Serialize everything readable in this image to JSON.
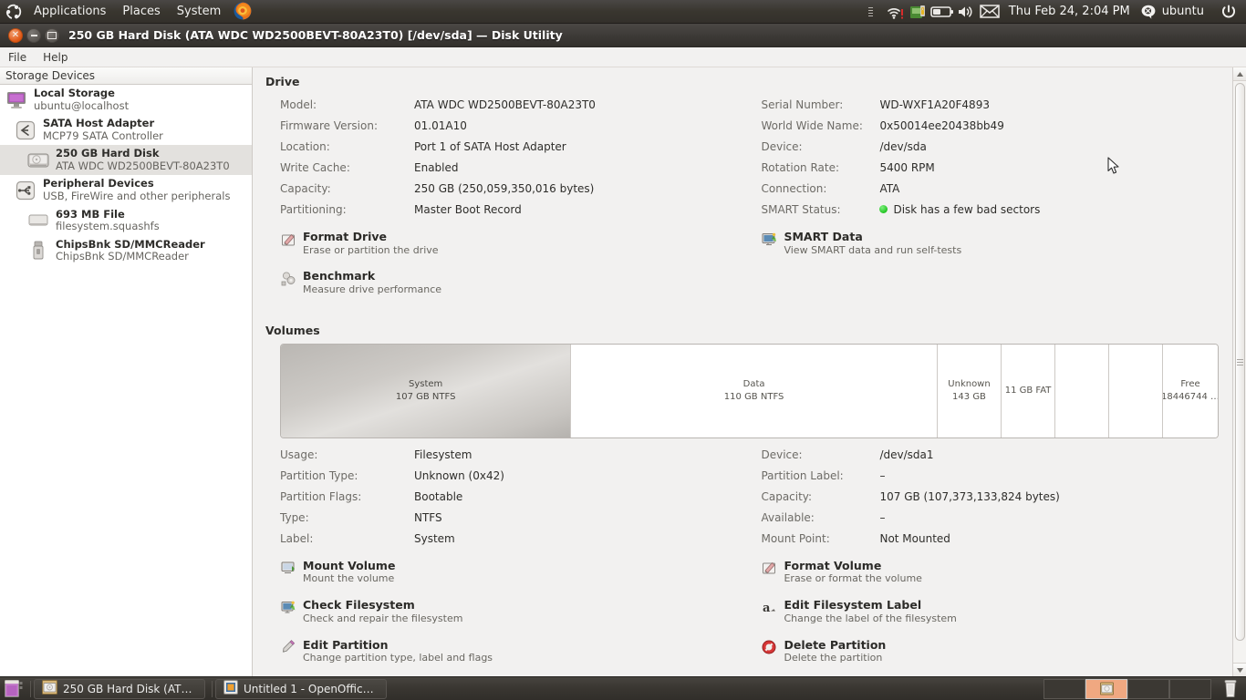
{
  "top_panel": {
    "menus": [
      "Applications",
      "Places",
      "System"
    ],
    "logo_icon": "ubuntu-logo-icon",
    "firefox_icon": "firefox-icon",
    "tray": [
      {
        "name": "network-wireless-icon",
        "label": ""
      },
      {
        "name": "network-manager-icon",
        "label": ""
      },
      {
        "name": "battery-icon",
        "label": ""
      },
      {
        "name": "volume-icon",
        "label": ""
      },
      {
        "name": "mail-envelope-icon",
        "label": ""
      }
    ],
    "clock": "Thu Feb 24,  2:04 PM",
    "user": "ubuntu",
    "power_icon": "power-icon"
  },
  "window": {
    "title": "250 GB Hard Disk (ATA WDC WD2500BEVT-80A23T0) [/dev/sda] — Disk Utility",
    "controls": {
      "close": "close-icon",
      "minimize": "minimize-icon",
      "maximize": "maximize-icon"
    },
    "menubar": [
      "File",
      "Help"
    ]
  },
  "sidebar": {
    "header": "Storage Devices",
    "items": [
      {
        "title": "Local Storage",
        "sub": "ubuntu@localhost",
        "icon": "computer-icon",
        "indent": 0,
        "selected": false
      },
      {
        "title": "SATA Host Adapter",
        "sub": "MCP79 SATA Controller",
        "icon": "sata-adapter-icon",
        "indent": 1,
        "selected": false
      },
      {
        "title": "250 GB Hard Disk",
        "sub": "ATA WDC WD2500BEVT-80A23T0",
        "icon": "harddisk-icon",
        "indent": 2,
        "selected": true
      },
      {
        "title": "Peripheral Devices",
        "sub": "USB, FireWire and other peripherals",
        "icon": "usb-icon",
        "indent": 1,
        "selected": false
      },
      {
        "title": "693 MB File",
        "sub": "filesystem.squashfs",
        "icon": "file-drive-icon",
        "indent": 2,
        "selected": false
      },
      {
        "title": "ChipsBnk SD/MMCReader",
        "sub": "ChipsBnk SD/MMCReader",
        "icon": "usb-stick-icon",
        "indent": 2,
        "selected": false
      }
    ]
  },
  "drive": {
    "section_title": "Drive",
    "left_fields": [
      {
        "label": "Model:",
        "value": "ATA WDC WD2500BEVT-80A23T0"
      },
      {
        "label": "Firmware Version:",
        "value": "01.01A10"
      },
      {
        "label": "Location:",
        "value": "Port 1 of SATA Host Adapter"
      },
      {
        "label": "Write Cache:",
        "value": "Enabled"
      },
      {
        "label": "Capacity:",
        "value": "250 GB (250,059,350,016 bytes)"
      },
      {
        "label": "Partitioning:",
        "value": "Master Boot Record"
      }
    ],
    "right_fields": [
      {
        "label": "Serial Number:",
        "value": "WD-WXF1A20F4893"
      },
      {
        "label": "World Wide Name:",
        "value": "0x50014ee20438bb49"
      },
      {
        "label": "Device:",
        "value": "/dev/sda"
      },
      {
        "label": "Rotation Rate:",
        "value": "5400 RPM"
      },
      {
        "label": "Connection:",
        "value": "ATA"
      },
      {
        "label": "SMART Status:",
        "value": "Disk has a few bad sectors",
        "dot_color": "#2fc32f"
      }
    ],
    "actions_left": [
      {
        "title": "Format Drive",
        "sub": "Erase or partition the drive",
        "icon": "format-drive-icon"
      },
      {
        "title": "Benchmark",
        "sub": "Measure drive performance",
        "icon": "benchmark-icon"
      }
    ],
    "actions_right": [
      {
        "title": "SMART Data",
        "sub": "View SMART data and run self-tests",
        "icon": "smart-data-icon"
      }
    ]
  },
  "volumes": {
    "section_title": "Volumes",
    "segments": [
      {
        "label": "System",
        "size": "107 GB NTFS",
        "width_pct": 31.3,
        "selected": true
      },
      {
        "label": "Data",
        "size": "110 GB NTFS",
        "width_pct": 39.5,
        "selected": false
      },
      {
        "label": "Unknown",
        "size": "143 GB",
        "width_pct": 6.9,
        "selected": false
      },
      {
        "label": "11 GB FAT",
        "size": "",
        "width_pct": 5.8,
        "selected": false
      },
      {
        "label": "",
        "size": "",
        "width_pct": 5.8,
        "selected": false
      },
      {
        "label": "",
        "size": "",
        "width_pct": 5.8,
        "selected": false
      },
      {
        "label": "Free",
        "size": "18446744 …",
        "width_pct": 5.9,
        "selected": false
      }
    ]
  },
  "volume_details": {
    "left_fields": [
      {
        "label": "Usage:",
        "value": "Filesystem"
      },
      {
        "label": "Partition Type:",
        "value": "Unknown (0x42)"
      },
      {
        "label": "Partition Flags:",
        "value": "Bootable"
      },
      {
        "label": "Type:",
        "value": "NTFS"
      },
      {
        "label": "Label:",
        "value": "System"
      }
    ],
    "right_fields": [
      {
        "label": "Device:",
        "value": "/dev/sda1"
      },
      {
        "label": "Partition Label:",
        "value": "–"
      },
      {
        "label": "Capacity:",
        "value": "107 GB (107,373,133,824 bytes)"
      },
      {
        "label": "Available:",
        "value": "–"
      },
      {
        "label": "Mount Point:",
        "value": "Not Mounted"
      }
    ],
    "actions_left": [
      {
        "title": "Mount Volume",
        "sub": "Mount the volume",
        "icon": "mount-volume-icon"
      },
      {
        "title": "Check Filesystem",
        "sub": "Check and repair the filesystem",
        "icon": "check-filesystem-icon"
      },
      {
        "title": "Edit Partition",
        "sub": "Change partition type, label and flags",
        "icon": "edit-partition-icon"
      }
    ],
    "actions_right": [
      {
        "title": "Format Volume",
        "sub": "Erase or format the volume",
        "icon": "format-volume-icon"
      },
      {
        "title": "Edit Filesystem Label",
        "sub": "Change the label of the filesystem",
        "icon": "edit-label-icon"
      },
      {
        "title": "Delete Partition",
        "sub": "Delete the partition",
        "icon": "delete-partition-icon"
      }
    ]
  },
  "taskbar": {
    "show_desktop_icon": "show-desktop-icon",
    "tasks": [
      {
        "label": "250 GB Hard Disk (AT…",
        "icon": "disk-utility-icon"
      },
      {
        "label": "Untitled 1 - OpenOffic…",
        "icon": "openoffice-icon"
      }
    ],
    "workspaces": [
      {
        "active": true
      },
      {
        "active": false
      },
      {
        "active": false
      },
      {
        "active": false
      }
    ],
    "trash_icon": "trash-icon"
  },
  "colors": {
    "panel_bg": "#39362f",
    "window_bg": "#f2f1f0",
    "selection": "#e3e1de",
    "smart_green": "#2fc32f",
    "accent_orange": "#df5613"
  }
}
